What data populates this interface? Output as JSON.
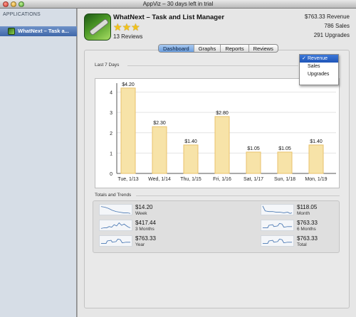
{
  "window": {
    "title": "AppViz – 30 days left in trial"
  },
  "sidebar": {
    "heading": "APPLICATIONS",
    "items": [
      {
        "label": "WhatNext – Task a..."
      }
    ]
  },
  "app": {
    "name": "WhatNext – Task and List Manager",
    "rating_stars": 3,
    "reviews": "13 Reviews"
  },
  "summary": {
    "revenue": "$763.33 Revenue",
    "sales": "786  Sales",
    "upgrades": "291  Upgrades"
  },
  "tabs": [
    {
      "label": "Dashboard",
      "active": true
    },
    {
      "label": "Graphs",
      "active": false
    },
    {
      "label": "Reports",
      "active": false
    },
    {
      "label": "Reviews",
      "active": false
    }
  ],
  "sections": {
    "last7": "Last 7 Days",
    "totals": "Totals and Trends"
  },
  "metric_menu": {
    "options": [
      "Revenue",
      "Sales",
      "Upgrades"
    ],
    "selected": "Revenue",
    "check": "✓"
  },
  "chart_data": {
    "type": "bar",
    "categories": [
      "Tue, 1/13",
      "Wed, 1/14",
      "Thu, 1/15",
      "Fri, 1/16",
      "Sat, 1/17",
      "Sun, 1/18",
      "Mon, 1/19"
    ],
    "values": [
      4.2,
      2.3,
      1.4,
      2.8,
      1.05,
      1.05,
      1.4
    ],
    "data_labels": [
      "$4.20",
      "$2.30",
      "$1.40",
      "$2.80",
      "$1.05",
      "$1.05",
      "$1.40"
    ],
    "yticks": [
      0,
      1,
      2,
      3,
      4
    ],
    "ylim": [
      0,
      4.3
    ],
    "grid": true,
    "bar_color": "#f7e3a8",
    "bar_stroke": "#e8c26b"
  },
  "totals": [
    {
      "value": "$14.20",
      "label": "Week"
    },
    {
      "value": "$417.44",
      "label": "3 Months"
    },
    {
      "value": "$763.33",
      "label": "Year"
    },
    {
      "value": "$118.05",
      "label": "Month"
    },
    {
      "value": "$763.33",
      "label": "6 Months"
    },
    {
      "value": "$763.33",
      "label": "Total"
    }
  ],
  "colors": {
    "selection": "#3f67a9",
    "tab_active": "#6b9fe0",
    "star": "#f3c318",
    "sparkline": "#4a78b3"
  }
}
